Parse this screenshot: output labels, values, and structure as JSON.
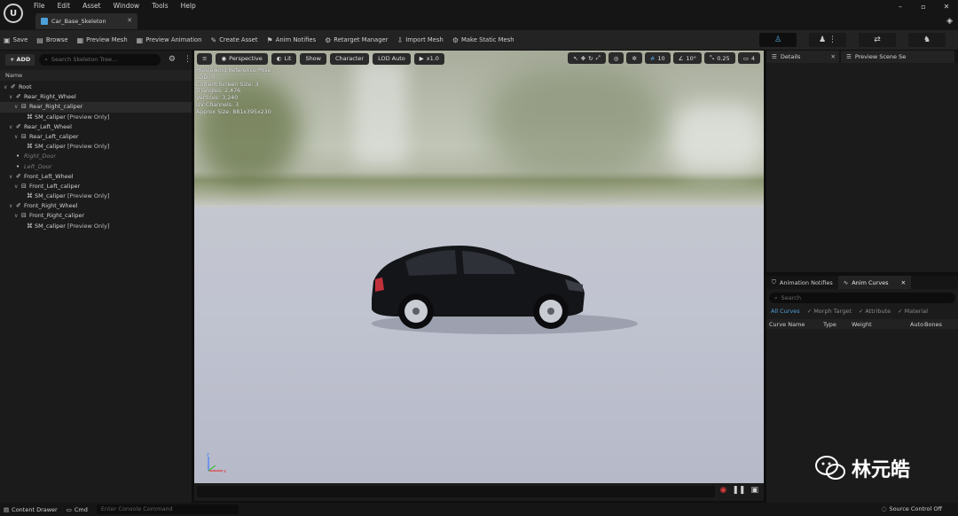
{
  "menu": {
    "file": "File",
    "edit": "Edit",
    "asset": "Asset",
    "window": "Window",
    "tools": "Tools",
    "help": "Help"
  },
  "document_tab": {
    "label": "Car_Base_Skeleton"
  },
  "toolbar": {
    "save": "Save",
    "browse": "Browse",
    "preview_mesh": "Preview Mesh",
    "preview_animation": "Preview Animation",
    "create_asset": "Create Asset",
    "anim_notifies": "Anim Notifies",
    "retarget_manager": "Retarget Manager",
    "import_mesh": "Import Mesh",
    "make_static_mesh": "Make Static Mesh"
  },
  "skeleton_tree": {
    "add_label": "ADD",
    "search_placeholder": "Search Skeleton Tree...",
    "column_name": "Name",
    "rows": [
      {
        "label": "Root",
        "preview": ""
      },
      {
        "label": "Rear_Right_Wheel",
        "preview": ""
      },
      {
        "label": "Rear_Right_caliper",
        "preview": ""
      },
      {
        "label": "SM_caliper",
        "preview": "[Preview Only]"
      },
      {
        "label": "Rear_Left_Wheel",
        "preview": ""
      },
      {
        "label": "Rear_Left_caliper",
        "preview": ""
      },
      {
        "label": "SM_caliper",
        "preview": "[Preview Only]"
      },
      {
        "label": "Right_Door",
        "preview": ""
      },
      {
        "label": "Left_Door",
        "preview": ""
      },
      {
        "label": "Front_Left_Wheel",
        "preview": ""
      },
      {
        "label": "Front_Left_caliper",
        "preview": ""
      },
      {
        "label": "SM_caliper",
        "preview": "[Preview Only]"
      },
      {
        "label": "Front_Right_Wheel",
        "preview": ""
      },
      {
        "label": "Front_Right_caliper",
        "preview": ""
      },
      {
        "label": "SM_caliper",
        "preview": "[Preview Only]"
      }
    ]
  },
  "viewport": {
    "perspective": "Perspective",
    "lit": "Lit",
    "show": "Show",
    "character": "Character",
    "lod": "LOD Auto",
    "play_rate": "x1.0",
    "grid_snap": "10",
    "rot_snap": "10°",
    "scale_snap": "0.25",
    "cam_speed": "4",
    "info": [
      "Previewing Reference Pose",
      "LOD: 0",
      "Current Screen Size: 3",
      "Triangles: 2,476",
      "Vertices: 3,240",
      "UV Channels: 3",
      "Approx Size: 881x395x230"
    ]
  },
  "details_panel": {
    "tab_details": "Details",
    "tab_preview": "Preview Scene Se"
  },
  "anim_panel": {
    "tab_notifies": "Animation Notifies",
    "tab_curves": "Anim Curves",
    "search_placeholder": "Search",
    "filters": {
      "all": "All Curves",
      "morph": "Morph Target",
      "attribute": "Attribute",
      "material": "Material"
    },
    "columns": {
      "curve_name": "Curve Name",
      "type": "Type",
      "weight": "Weight",
      "auto": "Auto",
      "bones": "Bones"
    }
  },
  "statusbar": {
    "content_drawer": "Content Drawer",
    "cmd": "Cmd",
    "console_placeholder": "Enter Console Command",
    "source_control": "Source Control Off"
  },
  "watermark": {
    "text": "林元皓"
  },
  "colors": {
    "accent": "#4ea0d8",
    "record": "#e23c3c",
    "panel_bg": "#1b1b1b"
  }
}
